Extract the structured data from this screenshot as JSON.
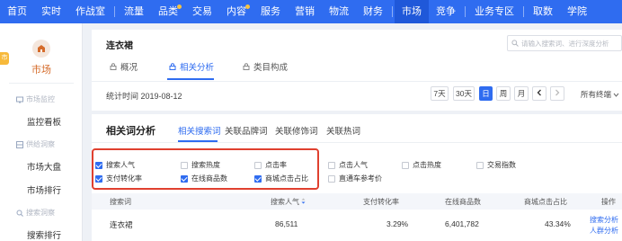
{
  "nav": {
    "items": [
      "首页",
      "实时",
      "作战室",
      "流量",
      "品类",
      "交易",
      "内容",
      "服务",
      "营销",
      "物流",
      "财务",
      "市场",
      "竞争",
      "业务专区",
      "取数",
      "学院"
    ],
    "active": "市场",
    "accent": "#2f6cf0"
  },
  "sidebar": {
    "badge": "市",
    "title": "市场",
    "group1": "市场监控",
    "link1": "监控看板",
    "group2": "供给洞察",
    "link2": "市场大盘",
    "link3": "市场排行",
    "group3": "搜索洞察",
    "link4": "搜索排行"
  },
  "header": {
    "title": "连衣裙",
    "search_placeholder": "请输入搜索词、进行深度分析",
    "tabs": [
      "概况",
      "相关分析",
      "类目构成"
    ],
    "active_tab": "相关分析",
    "stat_time": "统计时间 2019-08-12",
    "date_buttons": [
      "7天",
      "30天",
      "日",
      "周",
      "月"
    ],
    "active_date": "日",
    "terminal": "所有终端"
  },
  "section": {
    "title": "相关词分析",
    "tabs": [
      "相关搜索词",
      "关联品牌词",
      "关联修饰词",
      "关联热词"
    ],
    "active_tab": "相关搜索词"
  },
  "metrics": [
    {
      "label": "搜索人气",
      "checked": true
    },
    {
      "label": "搜索热度",
      "checked": false
    },
    {
      "label": "点击率",
      "checked": false
    },
    {
      "label": "点击人气",
      "checked": false
    },
    {
      "label": "点击热度",
      "checked": false
    },
    {
      "label": "交易指数",
      "checked": false
    },
    {
      "label": "支付转化率",
      "checked": true
    },
    {
      "label": "在线商品数",
      "checked": true
    },
    {
      "label": "商城点击占比",
      "checked": true
    },
    {
      "label": "直通车参考价",
      "checked": false
    }
  ],
  "table": {
    "headers": [
      "搜索词",
      "搜索人气",
      "支付转化率",
      "在线商品数",
      "商城点击占比",
      "操作"
    ],
    "sort_icon": "sort-icon",
    "rows": [
      {
        "keyword": "连衣裙",
        "search_popularity": "86,511",
        "pay_conversion": "3.29%",
        "online_products": "6,401,782",
        "mall_click_ratio": "43.34%",
        "action1": "搜索分析",
        "action2": "人群分析"
      }
    ]
  }
}
